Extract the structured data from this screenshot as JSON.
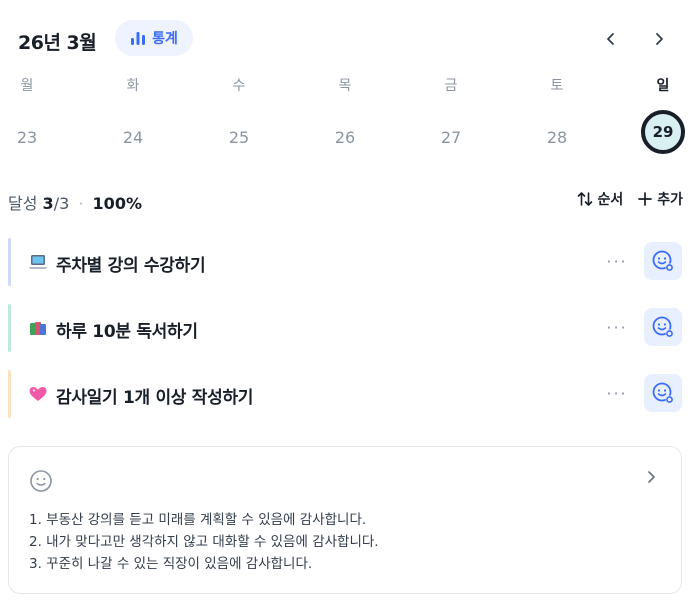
{
  "header": {
    "month_title": "26년 3월",
    "stats_label": "통계"
  },
  "week": [
    {
      "weekday": "월",
      "date": "23",
      "selected": false
    },
    {
      "weekday": "화",
      "date": "24",
      "selected": false
    },
    {
      "weekday": "수",
      "date": "25",
      "selected": false
    },
    {
      "weekday": "목",
      "date": "26",
      "selected": false
    },
    {
      "weekday": "금",
      "date": "27",
      "selected": false
    },
    {
      "weekday": "토",
      "date": "28",
      "selected": false
    },
    {
      "weekday": "일",
      "date": "29",
      "selected": true
    }
  ],
  "summary": {
    "label": "달성",
    "done": "3",
    "total": "/3",
    "separator": "·",
    "percent": "100%"
  },
  "actions": {
    "order_label": "순서",
    "add_label": "추가"
  },
  "tasks": [
    {
      "icon": "laptop-icon",
      "title": "주차별 강의 수강하기",
      "color": "#cfd8f6",
      "more": "···"
    },
    {
      "icon": "books-icon",
      "title": "하루 10분 독서하기",
      "color": "#bfe8e0",
      "more": "···"
    },
    {
      "icon": "heart-icon",
      "title": "감사일기 1개 이상 작성하기",
      "color": "#fbe0c0",
      "more": "···"
    }
  ],
  "journal": {
    "lines": [
      "1. 부동산 강의를 듣고 미래를 계획할 수 있음에 감사합니다.",
      "2. 내가 맞다고만 생각하지 않고 대화할 수 있음에 감사합니다.",
      "3. 꾸준히 나갈 수 있는 직장이 있음에 감사합니다."
    ]
  },
  "colors": {
    "accent": "#3b6cf6",
    "selected_date_bg": "#d9f0f3",
    "text_primary": "#191f28",
    "text_muted": "#8b95a1"
  }
}
